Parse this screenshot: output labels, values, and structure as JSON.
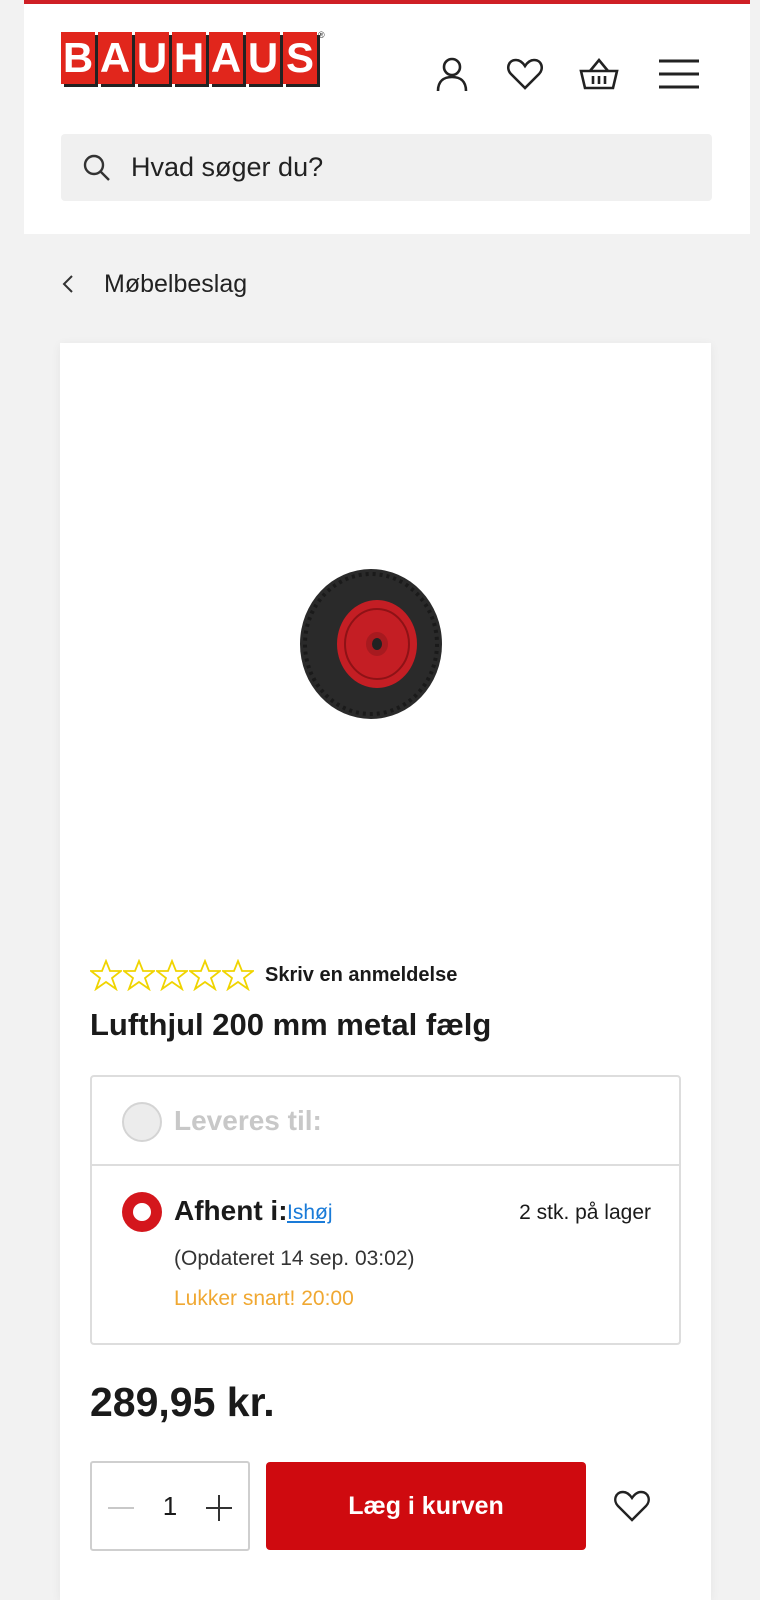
{
  "header": {
    "logo_text": "BAUHAUS",
    "logo_letters": [
      "B",
      "A",
      "U",
      "H",
      "A",
      "U",
      "S"
    ],
    "logo_reg": "®",
    "icons": [
      "user-icon",
      "heart-icon",
      "basket-icon",
      "menu-icon"
    ]
  },
  "search": {
    "placeholder": "Hvad søger du?"
  },
  "breadcrumb": {
    "label": "Møbelbeslag"
  },
  "product": {
    "rating_stars": 0,
    "rating_max": 5,
    "review_link": "Skriv en anmeldelse",
    "title": "Lufthjul 200 mm metal fælg",
    "price": "289,95 kr."
  },
  "delivery": {
    "option_delivery_label": "Leveres til:",
    "option_pickup_label": "Afhent i:",
    "store": "Ishøj",
    "stock": "2 stk. på lager",
    "updated": "(Opdateret 14 sep. 03:02)",
    "closing": "Lukker snart! 20:00"
  },
  "cart": {
    "quantity": "1",
    "add_label": "Læg i kurven"
  },
  "colors": {
    "brand_red": "#cf0a0f",
    "star_yellow": "#f0d400",
    "link_blue": "#1a7bd8",
    "warning_orange": "#f0a832"
  }
}
